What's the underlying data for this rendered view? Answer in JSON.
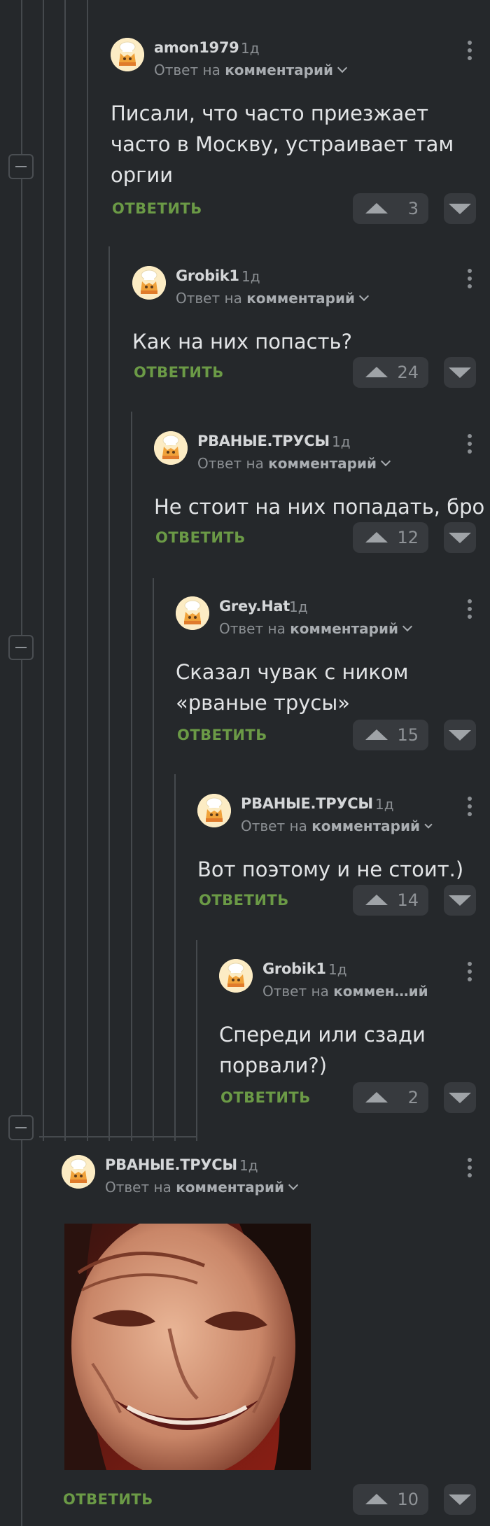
{
  "common": {
    "reply_prefix": "Ответ на",
    "reply_target": "комментарий",
    "reply_target_short": "коммен…ий",
    "reply_label": "ОТВЕТИТЬ"
  },
  "comments": [
    {
      "username": "amon1979",
      "time": "1д",
      "text_lines": [
        "Писали, что часто приезжает",
        "часто в Москву, устраивает там",
        "оргии"
      ],
      "rating": "3"
    },
    {
      "username": "Grobik1",
      "time": "1д",
      "text_lines": [
        "Как на них попасть?"
      ],
      "rating": "24"
    },
    {
      "username": "РВАНЫЕ.ТРУСЫ",
      "time": "1д",
      "text_lines": [
        "Не стоит на них попадать, бро"
      ],
      "rating": "12"
    },
    {
      "username": "Grey.Hat",
      "time": "1д",
      "text_lines": [
        "Сказал чувак с ником",
        "«рваные трусы»"
      ],
      "rating": "15"
    },
    {
      "username": "РВАНЫЕ.ТРУСЫ",
      "time": "1д",
      "text_lines": [
        "Вот поэтому и не стоит.)"
      ],
      "rating": "14"
    },
    {
      "username": "Grobik1",
      "time": "1д",
      "text_lines": [
        "Спереди или сзади",
        "порвали?)"
      ],
      "rating": "2"
    },
    {
      "username": "РВАНЫЕ.ТРУСЫ",
      "time": "1д",
      "text_lines": [],
      "rating": "10",
      "image": "smiling-man-photo"
    }
  ],
  "icons": {
    "avatar": "chef-cat-avatar-icon",
    "collapse": "minus-icon",
    "more": "more-vertical-icon",
    "upvote": "triangle-up-icon",
    "downvote": "triangle-down-icon"
  },
  "colors": {
    "background": "#25282b",
    "reply_green": "#6b9a46",
    "vote_bg": "#373a3e"
  }
}
